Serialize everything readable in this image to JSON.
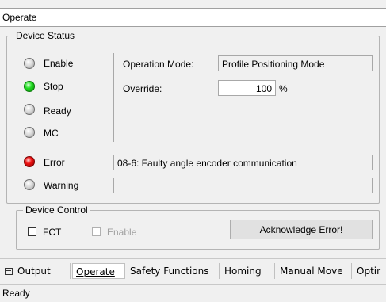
{
  "panel": {
    "title": "Operate"
  },
  "device_status": {
    "legend": "Device Status",
    "indicators": {
      "enable": {
        "label": "Enable",
        "state": "off"
      },
      "stop": {
        "label": "Stop",
        "state": "green"
      },
      "ready": {
        "label": "Ready",
        "state": "off"
      },
      "mc": {
        "label": "MC",
        "state": "off"
      },
      "error": {
        "label": "Error",
        "state": "red"
      },
      "warning": {
        "label": "Warning",
        "state": "off"
      }
    },
    "operation_mode": {
      "label": "Operation Mode:",
      "value": "Profile Positioning Mode"
    },
    "override": {
      "label": "Override:",
      "value": "100",
      "unit": "%"
    },
    "error_text": "08-6: Faulty angle encoder communication",
    "warning_text": ""
  },
  "device_control": {
    "legend": "Device Control",
    "fct_label": "FCT",
    "fct_checked": false,
    "enable_label": "Enable",
    "enable_checked": false,
    "enable_disabled": true,
    "acknowledge_button": "Acknowledge Error!"
  },
  "tabs": [
    {
      "label": "Output",
      "icon": "list-icon",
      "active": false
    },
    {
      "label": "Operate",
      "active": true
    },
    {
      "label": "Safety Functions",
      "active": false
    },
    {
      "label": "Homing",
      "active": false
    },
    {
      "label": "Manual Move",
      "active": false
    },
    {
      "label": "Optir",
      "active": false
    }
  ],
  "status_bar": {
    "text": "Ready"
  },
  "colors": {
    "led_green": "#22dd22",
    "led_red": "#ee1111",
    "led_off": "#c8c8c8",
    "background": "#f0f0f0"
  }
}
